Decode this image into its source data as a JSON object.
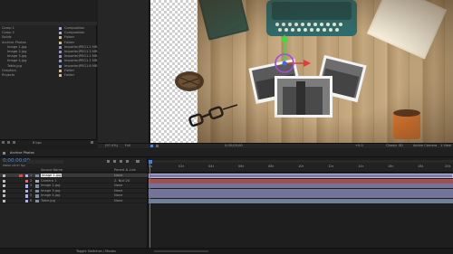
{
  "project": {
    "items": [
      {
        "name": "Comp 1",
        "type": "Composition",
        "size": "",
        "color": "#a8a8e0"
      },
      {
        "name": "Comp 2",
        "type": "Composition",
        "size": "",
        "color": "#a8a8e0"
      },
      {
        "name": "Solids",
        "type": "Folder",
        "size": "",
        "color": "#d8c060"
      },
      {
        "name": "Archive Photos",
        "type": "Folder",
        "size": "",
        "color": "#d8c060"
      },
      {
        "name": "Image 1.jpg",
        "type": "ImporterJPEG",
        "size": "1.2 MB",
        "color": "#8f8fd8"
      },
      {
        "name": "Image 2.jpg",
        "type": "ImporterJPEG",
        "size": "1.3 MB",
        "color": "#8f8fd8"
      },
      {
        "name": "Image 3.jpg",
        "type": "ImporterJPEG",
        "size": "1.2 MB",
        "color": "#8f8fd8"
      },
      {
        "name": "Image 4.jpg",
        "type": "ImporterJPEG",
        "size": "1.1 MB",
        "color": "#8f8fd8"
      },
      {
        "name": "Table.jpg",
        "type": "ImporterJPEG",
        "size": "1.8 MB",
        "color": "#8f8fd8"
      },
      {
        "name": "Graphics",
        "type": "Folder",
        "size": "",
        "color": "#d8c060"
      },
      {
        "name": "Projects",
        "type": "Folder",
        "size": "",
        "color": "#d8c060"
      }
    ],
    "bpc": "8 bpc"
  },
  "viewer": {
    "zoom": "(97.4%)",
    "resolution": "Full",
    "timecode": "0;00;00;00",
    "camera": "Active Camera",
    "view": "1 View",
    "renderer": "Classic 3D",
    "exposure": "+0.0"
  },
  "timeline": {
    "tab": "Archive Photos",
    "timecode": "0;00;00;00",
    "frame_info": "00000 (29.97 fps)",
    "col_source": "Source Name",
    "col_parent": "Parent & Link",
    "ruler": [
      "0s",
      "02s",
      "04s",
      "06s",
      "08s",
      "10s",
      "12s",
      "14s",
      "16s",
      "18s",
      "20s"
    ],
    "layers": [
      {
        "num": "1",
        "name": "Image 1.jpg",
        "parent": "None",
        "label": "#b0b0e8",
        "bar": "#7d7da3"
      },
      {
        "num": "2",
        "name": "Camera 1",
        "parent": "2. Null 20",
        "label": "#d07070",
        "bar": "#a05050"
      },
      {
        "num": "3",
        "name": "Image 2.jpg",
        "parent": "None",
        "label": "#b0b0e8",
        "bar": "#74749a"
      },
      {
        "num": "4",
        "name": "Image 3.jpg",
        "parent": "None",
        "label": "#b0b0e8",
        "bar": "#74749a"
      },
      {
        "num": "5",
        "name": "Image 4.jpg",
        "parent": "None",
        "label": "#b0b0e8",
        "bar": "#74749a"
      },
      {
        "num": "6",
        "name": "Table.jpg",
        "parent": "None",
        "label": "#b0b0e8",
        "bar": "#6f7f96"
      }
    ],
    "status": "Toggle Switches / Modes"
  }
}
